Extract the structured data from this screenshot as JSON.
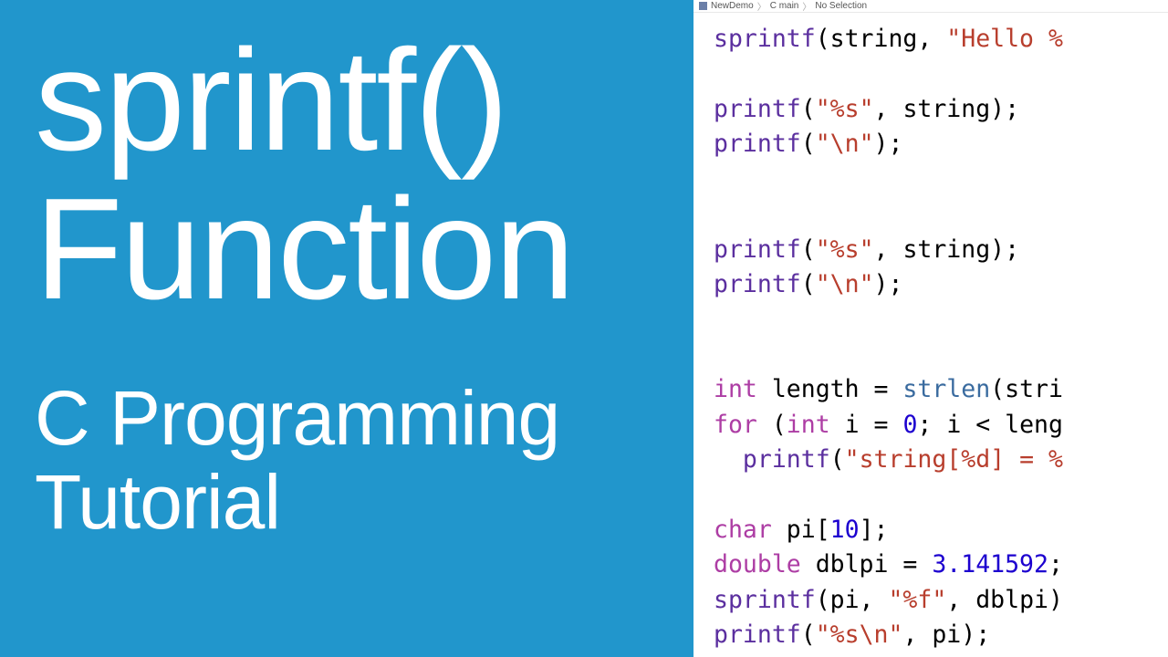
{
  "left": {
    "title_l1": "sprintf()",
    "title_l2": "Function",
    "subtitle_l1": "C Programming",
    "subtitle_l2": "Tutorial"
  },
  "breadcrumb": {
    "project": "NewDemo",
    "symbol": "C  main",
    "selection": "No Selection"
  },
  "code": {
    "l01_fn": "sprintf",
    "l01_a": "(string, ",
    "l01_s": "\"Hello %",
    "l02_fn": "printf",
    "l02_a": "(",
    "l02_s": "\"%s\"",
    "l02_b": ", string);",
    "l03_fn": "printf",
    "l03_a": "(",
    "l03_s": "\"\\n\"",
    "l03_b": ");",
    "l04_fn": "printf",
    "l04_a": "(",
    "l04_s": "\"%s\"",
    "l04_b": ", string);",
    "l05_fn": "printf",
    "l05_a": "(",
    "l05_s": "\"\\n\"",
    "l05_b": ");",
    "l06_kw": "int",
    "l06_a": " length = ",
    "l06_fn": "strlen",
    "l06_b": "(stri",
    "l07_kw1": "for",
    "l07_a": " (",
    "l07_kw2": "int",
    "l07_b": " i = ",
    "l07_n": "0",
    "l07_c": "; i < leng",
    "l08_pad": "  ",
    "l08_fn": "printf",
    "l08_a": "(",
    "l08_s": "\"string[%d] = %",
    "l09_kw": "char",
    "l09_a": " pi[",
    "l09_n": "10",
    "l09_b": "];",
    "l10_kw": "double",
    "l10_a": " dblpi = ",
    "l10_n": "3.141592",
    "l10_b": ";",
    "l11_fn": "sprintf",
    "l11_a": "(pi, ",
    "l11_s": "\"%f\"",
    "l11_b": ", dblpi)",
    "l12_fn": "printf",
    "l12_a": "(",
    "l12_s": "\"%s\\n\"",
    "l12_b": ", pi);"
  }
}
